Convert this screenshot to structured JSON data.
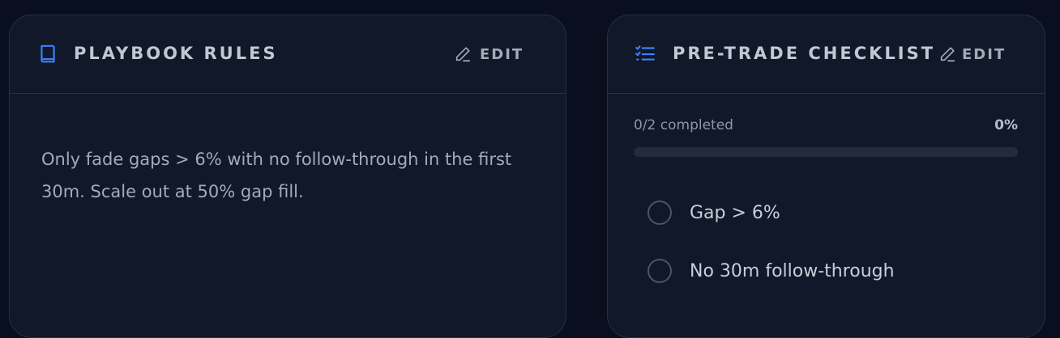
{
  "playbook": {
    "title": "PLAYBOOK RULES",
    "edit_label": "EDIT",
    "icon": "book-icon",
    "rules": "Only fade gaps > 6% with no follow-through in the first 30m. Scale out at 50% gap fill."
  },
  "checklist": {
    "title": "PRE-TRADE CHECKLIST",
    "edit_label": "EDIT",
    "icon": "list-checks-icon",
    "progress_label": "0/2 completed",
    "progress_percent_text": "0%",
    "progress_percent": 0,
    "items": [
      {
        "label": "Gap > 6%",
        "checked": false
      },
      {
        "label": "No 30m follow-through",
        "checked": false
      }
    ]
  },
  "colors": {
    "accent": "#3b82f6",
    "background": "#0a0f1f",
    "card": "#101829"
  }
}
